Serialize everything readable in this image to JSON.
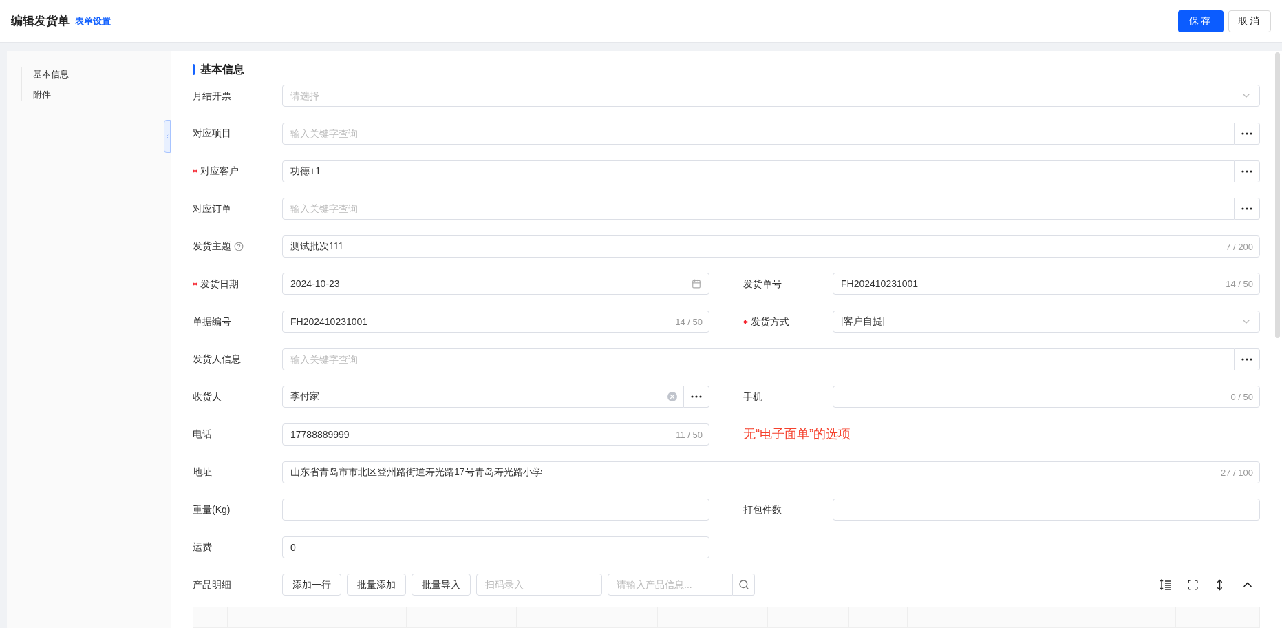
{
  "header": {
    "title": "编辑发货单",
    "link": "表单设置",
    "buttons": [
      {
        "label": "保存",
        "primary": true
      },
      {
        "label": "取消",
        "primary": false
      }
    ]
  },
  "sidebar": {
    "items": [
      {
        "label": "基本信息"
      },
      {
        "label": "附件"
      }
    ]
  },
  "section_title": "基本信息",
  "rows": [
    {
      "kind": "full",
      "fields": [
        {
          "label": "月结开票",
          "required": false,
          "help": false,
          "input": {
            "kind": "select",
            "placeholder": "请选择"
          }
        }
      ]
    },
    {
      "kind": "full",
      "fields": [
        {
          "label": "对应项目",
          "required": false,
          "help": false,
          "input": {
            "kind": "lookup",
            "placeholder": "输入关键字查询",
            "clearable": false
          }
        }
      ]
    },
    {
      "kind": "full",
      "fields": [
        {
          "label": "对应客户",
          "required": true,
          "help": false,
          "input": {
            "kind": "lookup",
            "value": "功德+1",
            "clearable": false
          }
        }
      ]
    },
    {
      "kind": "full",
      "fields": [
        {
          "label": "对应订单",
          "required": false,
          "help": false,
          "input": {
            "kind": "lookup",
            "placeholder": "输入关键字查询",
            "clearable": false
          }
        }
      ]
    },
    {
      "kind": "full",
      "fields": [
        {
          "label": "发货主题",
          "required": false,
          "help": true,
          "input": {
            "kind": "text",
            "value": "测试批次111",
            "counter": "7 / 200"
          }
        }
      ]
    },
    {
      "kind": "pair",
      "fields": [
        {
          "label": "发货日期",
          "required": true,
          "help": false,
          "input": {
            "kind": "date",
            "value": "2024-10-23"
          }
        },
        {
          "label": "发货单号",
          "required": false,
          "help": false,
          "input": {
            "kind": "text",
            "value": "FH202410231001",
            "counter": "14 / 50"
          }
        }
      ]
    },
    {
      "kind": "pair",
      "fields": [
        {
          "label": "单据编号",
          "required": false,
          "help": false,
          "input": {
            "kind": "text",
            "value": "FH202410231001",
            "counter": "14 / 50"
          }
        },
        {
          "label": "发货方式",
          "required": true,
          "help": false,
          "input": {
            "kind": "select",
            "value": "[客户自提]"
          }
        }
      ]
    },
    {
      "kind": "full",
      "fields": [
        {
          "label": "发货人信息",
          "required": false,
          "help": false,
          "input": {
            "kind": "lookup",
            "placeholder": "输入关键字查询",
            "clearable": false
          }
        }
      ]
    },
    {
      "kind": "pair",
      "fields": [
        {
          "label": "收货人",
          "required": false,
          "help": false,
          "input": {
            "kind": "lookup",
            "value": "李付家",
            "clearable": true
          }
        },
        {
          "label": "手机",
          "required": false,
          "help": false,
          "input": {
            "kind": "text",
            "counter": "0 / 50"
          }
        }
      ]
    },
    {
      "kind": "pair",
      "fields": [
        {
          "label": "电话",
          "required": false,
          "help": false,
          "input": {
            "kind": "text",
            "value": "17788889999",
            "counter": "11 / 50"
          }
        },
        {
          "kind": "note",
          "text": "无“电子面单”的选项"
        }
      ]
    },
    {
      "kind": "full",
      "fields": [
        {
          "label": "地址",
          "required": false,
          "help": false,
          "input": {
            "kind": "text",
            "value": "山东省青岛市市北区登州路街道寿光路17号青岛寿光路小学",
            "counter": "27 / 100"
          }
        }
      ]
    },
    {
      "kind": "pair",
      "fields": [
        {
          "label": "重量(Kg)",
          "required": false,
          "help": false,
          "input": {
            "kind": "text"
          }
        },
        {
          "label": "打包件数",
          "required": false,
          "help": false,
          "input": {
            "kind": "text"
          }
        }
      ]
    },
    {
      "kind": "pair",
      "fields": [
        {
          "label": "运费",
          "required": false,
          "help": false,
          "input": {
            "kind": "text",
            "value": "0"
          }
        }
      ]
    }
  ],
  "product_toolbar": {
    "label": "产品明细",
    "buttons": [
      "添加一行",
      "批量添加",
      "批量导入"
    ],
    "scan_field": {
      "placeholder": "扫码录入"
    },
    "search_field": {
      "placeholder": "请输入产品信息..."
    }
  }
}
